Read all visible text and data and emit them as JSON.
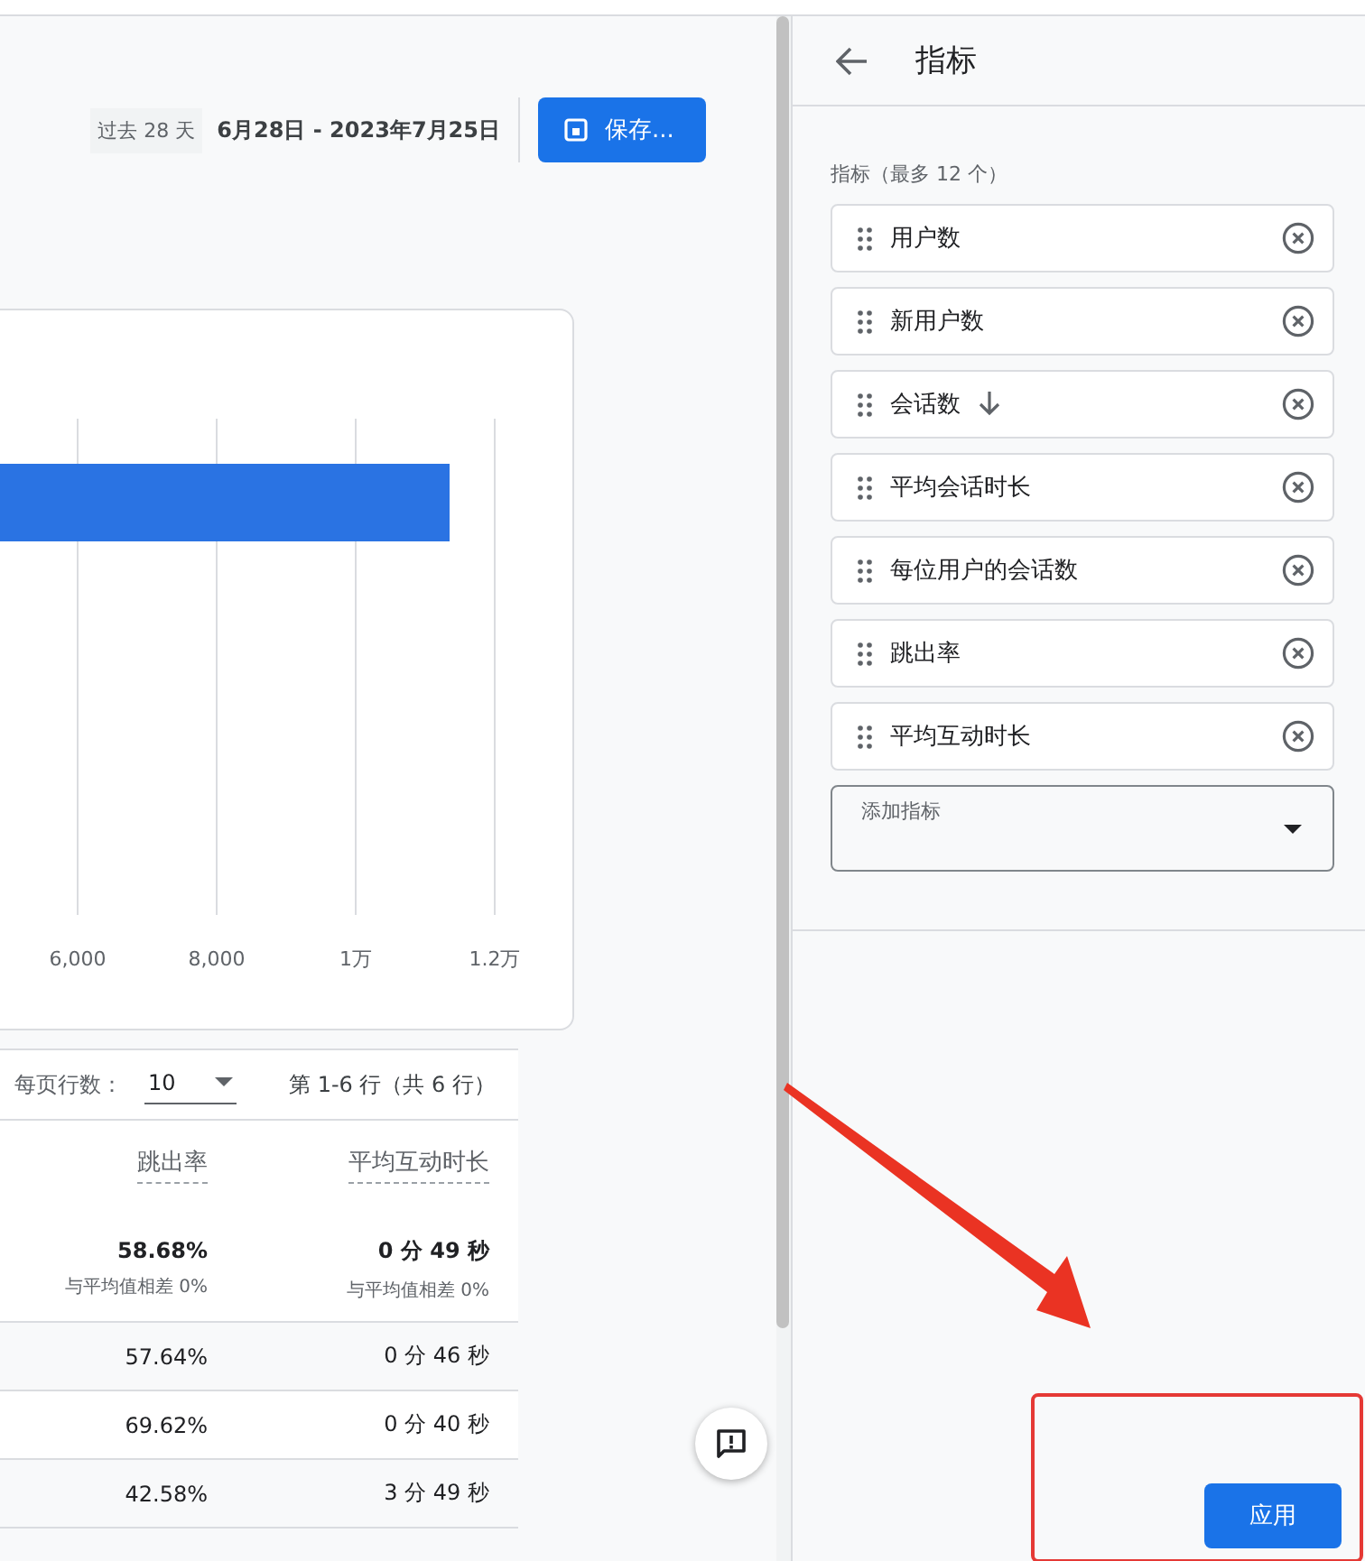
{
  "header": {
    "date_preset": "过去 28 天",
    "date_range": "6月28日 - 2023年7月25日",
    "save_button": "保存..."
  },
  "chart": {
    "tick_labels": [
      "6,000",
      "8,000",
      "1万",
      "1.2万"
    ]
  },
  "table": {
    "rows_per_page_label": "每页行数：",
    "rows_per_page": "10",
    "page_info": "第 1-6 行（共 6 行）",
    "columns": [
      "跳出率",
      "平均互动时长"
    ],
    "totals": [
      {
        "value": "58.68%",
        "note": "与平均值相差 0%"
      },
      {
        "value": "0 分 49 秒",
        "note": "与平均值相差 0%"
      }
    ],
    "rows": [
      [
        "57.64%",
        "0 分 46 秒"
      ],
      [
        "69.62%",
        "0 分 40 秒"
      ],
      [
        "42.58%",
        "3 分 49 秒"
      ]
    ]
  },
  "panel": {
    "title": "指标",
    "list_label": "指标（最多 12 个）",
    "metrics": [
      {
        "name": "用户数",
        "sorted": false
      },
      {
        "name": "新用户数",
        "sorted": false
      },
      {
        "name": "会话数",
        "sorted": true
      },
      {
        "name": "平均会话时长",
        "sorted": false
      },
      {
        "name": "每位用户的会话数",
        "sorted": false
      },
      {
        "name": "跳出率",
        "sorted": false
      },
      {
        "name": "平均互动时长",
        "sorted": false
      }
    ],
    "add_field": {
      "label": "添加指标"
    },
    "apply_button": "应用"
  }
}
